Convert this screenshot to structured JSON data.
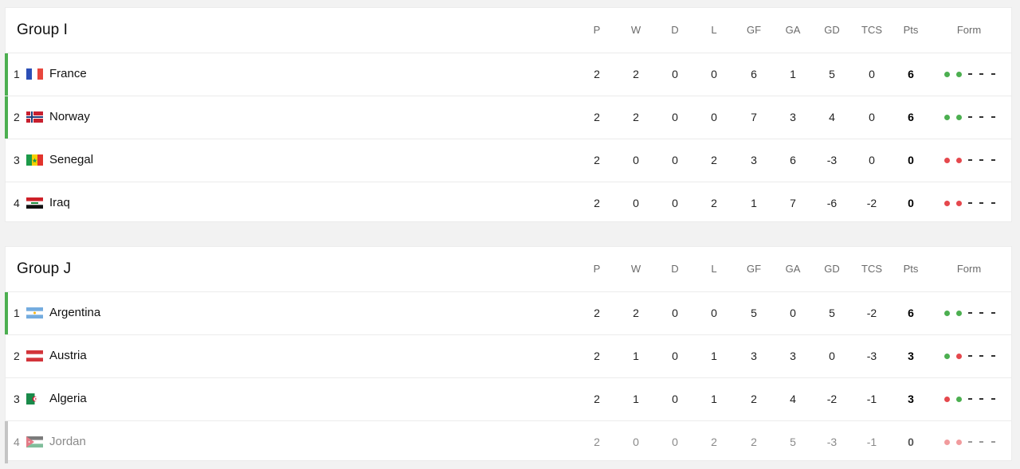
{
  "columns": [
    "P",
    "W",
    "D",
    "L",
    "GF",
    "GA",
    "GD",
    "TCS",
    "Pts",
    "Form"
  ],
  "colors": {
    "qualified_bar": "#4caf50",
    "eliminated_bar": "#c4c4c4",
    "win": "#4caf50",
    "loss": "#e5484d"
  },
  "groups": [
    {
      "title": "Group I",
      "rows": [
        {
          "pos": "1",
          "team": "France",
          "flag": "france-flag",
          "status": "qualified",
          "P": "2",
          "W": "2",
          "D": "0",
          "L": "0",
          "GF": "6",
          "GA": "1",
          "GD": "5",
          "TCS": "0",
          "Pts": "6",
          "form": [
            "W",
            "W",
            "-",
            "-",
            "-"
          ]
        },
        {
          "pos": "2",
          "team": "Norway",
          "flag": "norway-flag",
          "status": "qualified",
          "P": "2",
          "W": "2",
          "D": "0",
          "L": "0",
          "GF": "7",
          "GA": "3",
          "GD": "4",
          "TCS": "0",
          "Pts": "6",
          "form": [
            "W",
            "W",
            "-",
            "-",
            "-"
          ]
        },
        {
          "pos": "3",
          "team": "Senegal",
          "flag": "senegal-flag",
          "status": "none",
          "P": "2",
          "W": "0",
          "D": "0",
          "L": "2",
          "GF": "3",
          "GA": "6",
          "GD": "-3",
          "TCS": "0",
          "Pts": "0",
          "form": [
            "L",
            "L",
            "-",
            "-",
            "-"
          ]
        },
        {
          "pos": "4",
          "team": "Iraq",
          "flag": "iraq-flag",
          "status": "none",
          "P": "2",
          "W": "0",
          "D": "0",
          "L": "2",
          "GF": "1",
          "GA": "7",
          "GD": "-6",
          "TCS": "-2",
          "Pts": "0",
          "form": [
            "L",
            "L",
            "-",
            "-",
            "-"
          ]
        }
      ]
    },
    {
      "title": "Group J",
      "rows": [
        {
          "pos": "1",
          "team": "Argentina",
          "flag": "argentina-flag",
          "status": "qualified",
          "P": "2",
          "W": "2",
          "D": "0",
          "L": "0",
          "GF": "5",
          "GA": "0",
          "GD": "5",
          "TCS": "-2",
          "Pts": "6",
          "form": [
            "W",
            "W",
            "-",
            "-",
            "-"
          ]
        },
        {
          "pos": "2",
          "team": "Austria",
          "flag": "austria-flag",
          "status": "none",
          "P": "2",
          "W": "1",
          "D": "0",
          "L": "1",
          "GF": "3",
          "GA": "3",
          "GD": "0",
          "TCS": "-3",
          "Pts": "3",
          "form": [
            "W",
            "L",
            "-",
            "-",
            "-"
          ]
        },
        {
          "pos": "3",
          "team": "Algeria",
          "flag": "algeria-flag",
          "status": "none",
          "P": "2",
          "W": "1",
          "D": "0",
          "L": "1",
          "GF": "2",
          "GA": "4",
          "GD": "-2",
          "TCS": "-1",
          "Pts": "3",
          "form": [
            "L",
            "W",
            "-",
            "-",
            "-"
          ]
        },
        {
          "pos": "4",
          "team": "Jordan",
          "flag": "jordan-flag",
          "status": "eliminated",
          "P": "2",
          "W": "0",
          "D": "0",
          "L": "2",
          "GF": "2",
          "GA": "5",
          "GD": "-3",
          "TCS": "-1",
          "Pts": "0",
          "form": [
            "L",
            "L",
            "-",
            "-",
            "-"
          ]
        }
      ]
    }
  ]
}
